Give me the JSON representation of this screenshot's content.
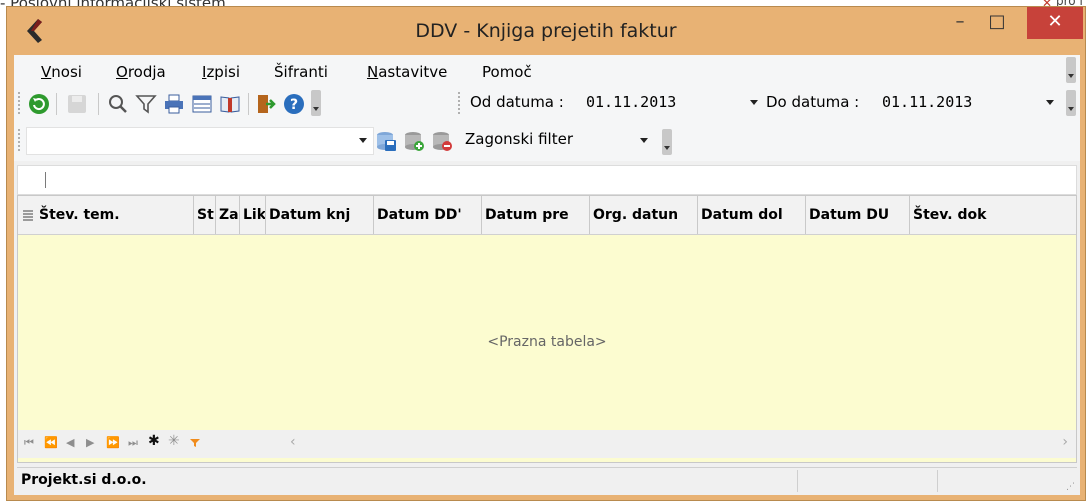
{
  "background": {
    "parent_title": "- Poslovni informacijski sistem",
    "parent_right": "pro i"
  },
  "window": {
    "title": "DDV - Knjiga prejetih faktur",
    "minimize_glyph": "–",
    "maximize_glyph": "□",
    "close_glyph": "✕"
  },
  "menu": {
    "items": [
      {
        "accel": "V",
        "rest": "nosi"
      },
      {
        "accel": "O",
        "rest": "rodja"
      },
      {
        "accel": "I",
        "rest": "zpisi"
      },
      {
        "accel": "",
        "rest": "Šifranti"
      },
      {
        "accel": "N",
        "rest": "astavitve"
      },
      {
        "accel": "",
        "rest": "Pomoč"
      }
    ]
  },
  "toolbar": {
    "icons": [
      "refresh-icon",
      "save-disabled-icon",
      "search-icon",
      "filter-icon",
      "print-icon",
      "table-view-icon",
      "book-icon",
      "exit-icon",
      "help-icon"
    ]
  },
  "dates": {
    "from_label": "Od datuma :",
    "from_value": "01.11.2013",
    "to_label": "Do datuma :",
    "to_value": "01.11.2013"
  },
  "filter": {
    "selected": "",
    "button_label": "Zagonski filter"
  },
  "table": {
    "columns": [
      "Štev. tem.",
      "St",
      "Za",
      "Lik",
      "Datum knj",
      "Datum DD'",
      "Datum pre",
      "Org. datun",
      "Datum dol",
      "Datum DU",
      "Štev. dok"
    ],
    "empty_text": "<Prazna tabela>"
  },
  "status": {
    "company": "Projekt.si d.o.o."
  },
  "colors": {
    "frame": "#e8b274",
    "close_button": "#c7423a",
    "grid_background": "#fcfcd0"
  }
}
